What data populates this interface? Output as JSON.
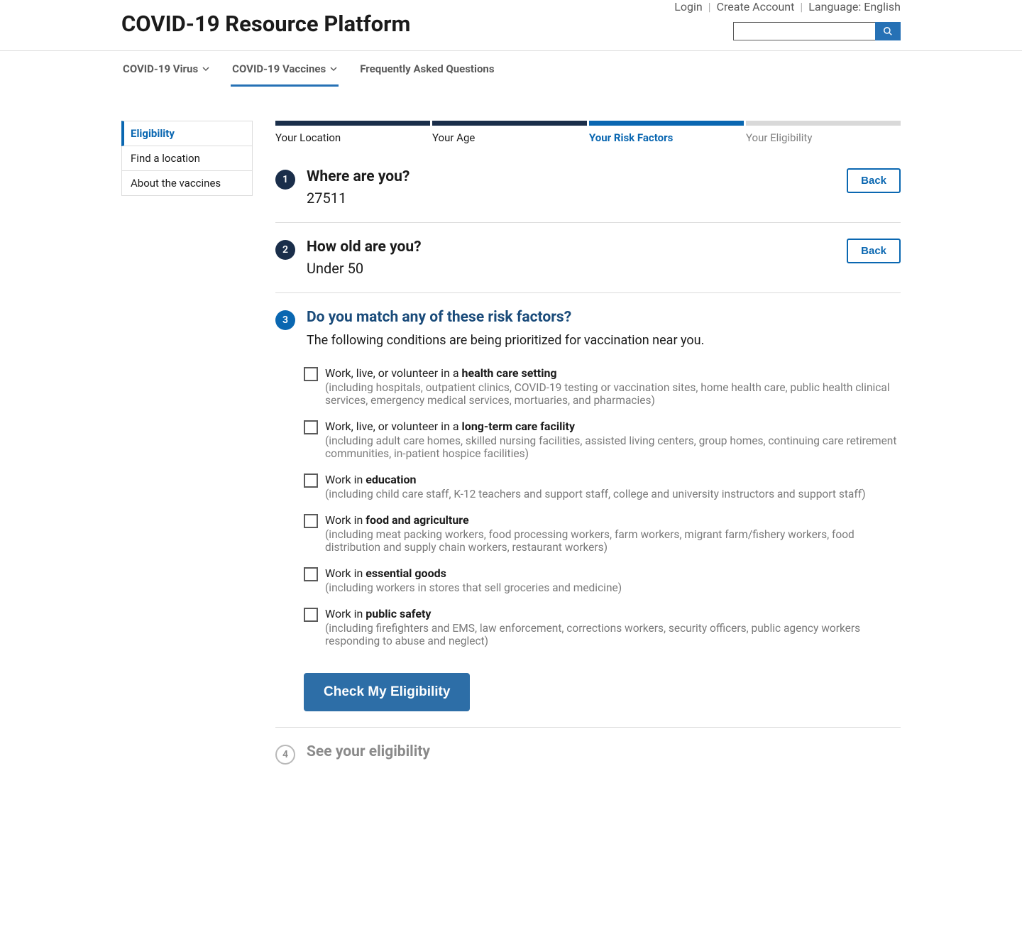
{
  "header": {
    "site_title": "COVID-19 Resource Platform",
    "login": "Login",
    "create_account": "Create Account",
    "language": "Language: English"
  },
  "nav": [
    {
      "label": "COVID-19 Virus",
      "dropdown": true,
      "active": false
    },
    {
      "label": "COVID-19 Vaccines",
      "dropdown": true,
      "active": true
    },
    {
      "label": "Frequently Asked Questions",
      "dropdown": false,
      "active": false
    }
  ],
  "sidebar": [
    {
      "label": "Eligibility",
      "active": true
    },
    {
      "label": "Find a location",
      "active": false
    },
    {
      "label": "About the vaccines",
      "active": false
    }
  ],
  "progress": [
    {
      "label": "Your Location",
      "state": "done"
    },
    {
      "label": "Your Age",
      "state": "done"
    },
    {
      "label": "Your Risk Factors",
      "state": "current"
    },
    {
      "label": "Your Eligibility",
      "state": "future"
    }
  ],
  "back_label": "Back",
  "steps": {
    "s1": {
      "num": "1",
      "title": "Where are you?",
      "value": "27511"
    },
    "s2": {
      "num": "2",
      "title": "How old are you?",
      "value": "Under 50"
    },
    "s3": {
      "num": "3",
      "title": "Do you match any of these risk factors?",
      "desc": "The following conditions are being prioritized for vaccination near you."
    },
    "s4": {
      "num": "4",
      "title": "See your eligibility"
    }
  },
  "risk_factors": [
    {
      "prefix": "Work, live, or volunteer in a ",
      "bold": "health care setting",
      "sub": "(including hospitals, outpatient clinics, COVID-19 testing or vaccination sites, home health care, public health clinical services, emergency medical services, mortuaries, and pharmacies)"
    },
    {
      "prefix": "Work, live, or volunteer in a ",
      "bold": "long-term care facility",
      "sub": "(including adult care homes, skilled nursing facilities, assisted living centers, group homes, continuing care retirement communities, in-patient hospice facilities)"
    },
    {
      "prefix": "Work in ",
      "bold": "education",
      "sub": "(including child care staff, K-12 teachers and support staff, college and university instructors and support staff)"
    },
    {
      "prefix": "Work in ",
      "bold": "food and agriculture",
      "sub": "(including meat packing workers, food processing workers, farm workers, migrant farm/fishery workers, food distribution and supply chain workers, restaurant workers)"
    },
    {
      "prefix": "Work in ",
      "bold": "essential goods",
      "sub": "(including workers in stores that sell groceries and medicine)"
    },
    {
      "prefix": "Work in ",
      "bold": "public safety",
      "sub": "(including firefighters and EMS, law enforcement, corrections workers, security officers, public agency workers responding to abuse and neglect)"
    }
  ],
  "submit_label": "Check My Eligibility"
}
